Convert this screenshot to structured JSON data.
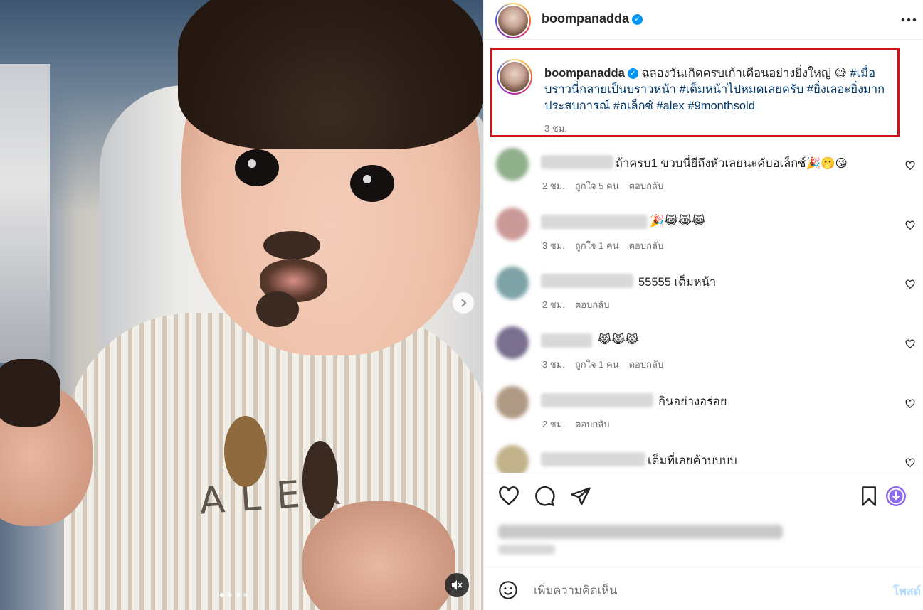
{
  "media": {
    "bib_text": "ALEX",
    "dots_total": 4,
    "dots_active_index": 0
  },
  "post": {
    "username": "boompanadda",
    "verified": true
  },
  "caption": {
    "username": "boompanadda",
    "text": "ฉลองวันเกิดครบเก้าเดือนอย่างยิ่งใหญ่ 😅",
    "hashtags": "#เมื่อบราวนี่กลายเป็นบราวหน้า #เต็มหน้าไปหมดเลยครับ #ยิ่งเลอะยิ่งมากประสบการณ์ #อเล็กซ์ #alex #9monthsold",
    "time": "3 ชม."
  },
  "comments": [
    {
      "text": "ถ้าครบ1 ขวบนี่ยีถึงหัวเลยนะคับอเล็กซ์🎉🫢😘",
      "time": "2 ชม.",
      "likes": "ถูกใจ 5 คน",
      "reply": "ตอบกลับ"
    },
    {
      "text": "🎉😹😹😹",
      "time": "3 ชม.",
      "likes": "ถูกใจ 1 คน",
      "reply": "ตอบกลับ"
    },
    {
      "text": "55555 เต็มหน้า",
      "time": "2 ชม.",
      "likes": "",
      "reply": "ตอบกลับ"
    },
    {
      "text": "😹😹😹",
      "time": "3 ชม.",
      "likes": "ถูกใจ 1 คน",
      "reply": "ตอบกลับ"
    },
    {
      "text": "กินอย่างอร่อย",
      "time": "2 ชม.",
      "likes": "",
      "reply": "ตอบกลับ"
    },
    {
      "text": "เต็มที่เลยค้าบบบบ",
      "time": "",
      "likes": "",
      "reply": ""
    }
  ],
  "composer": {
    "placeholder": "เพิ่มความคิดเห็น",
    "post_label": "โพสต์"
  },
  "icons": {
    "like": "heart-icon",
    "comment": "comment-icon",
    "share": "send-icon",
    "save": "bookmark-icon",
    "download": "download-icon",
    "emoji": "emoji-icon",
    "more": "more-icon"
  },
  "colors": {
    "link": "#00376b",
    "verified": "#0095f6",
    "highlight_box": "#d0131a",
    "muted_text": "#737373"
  }
}
